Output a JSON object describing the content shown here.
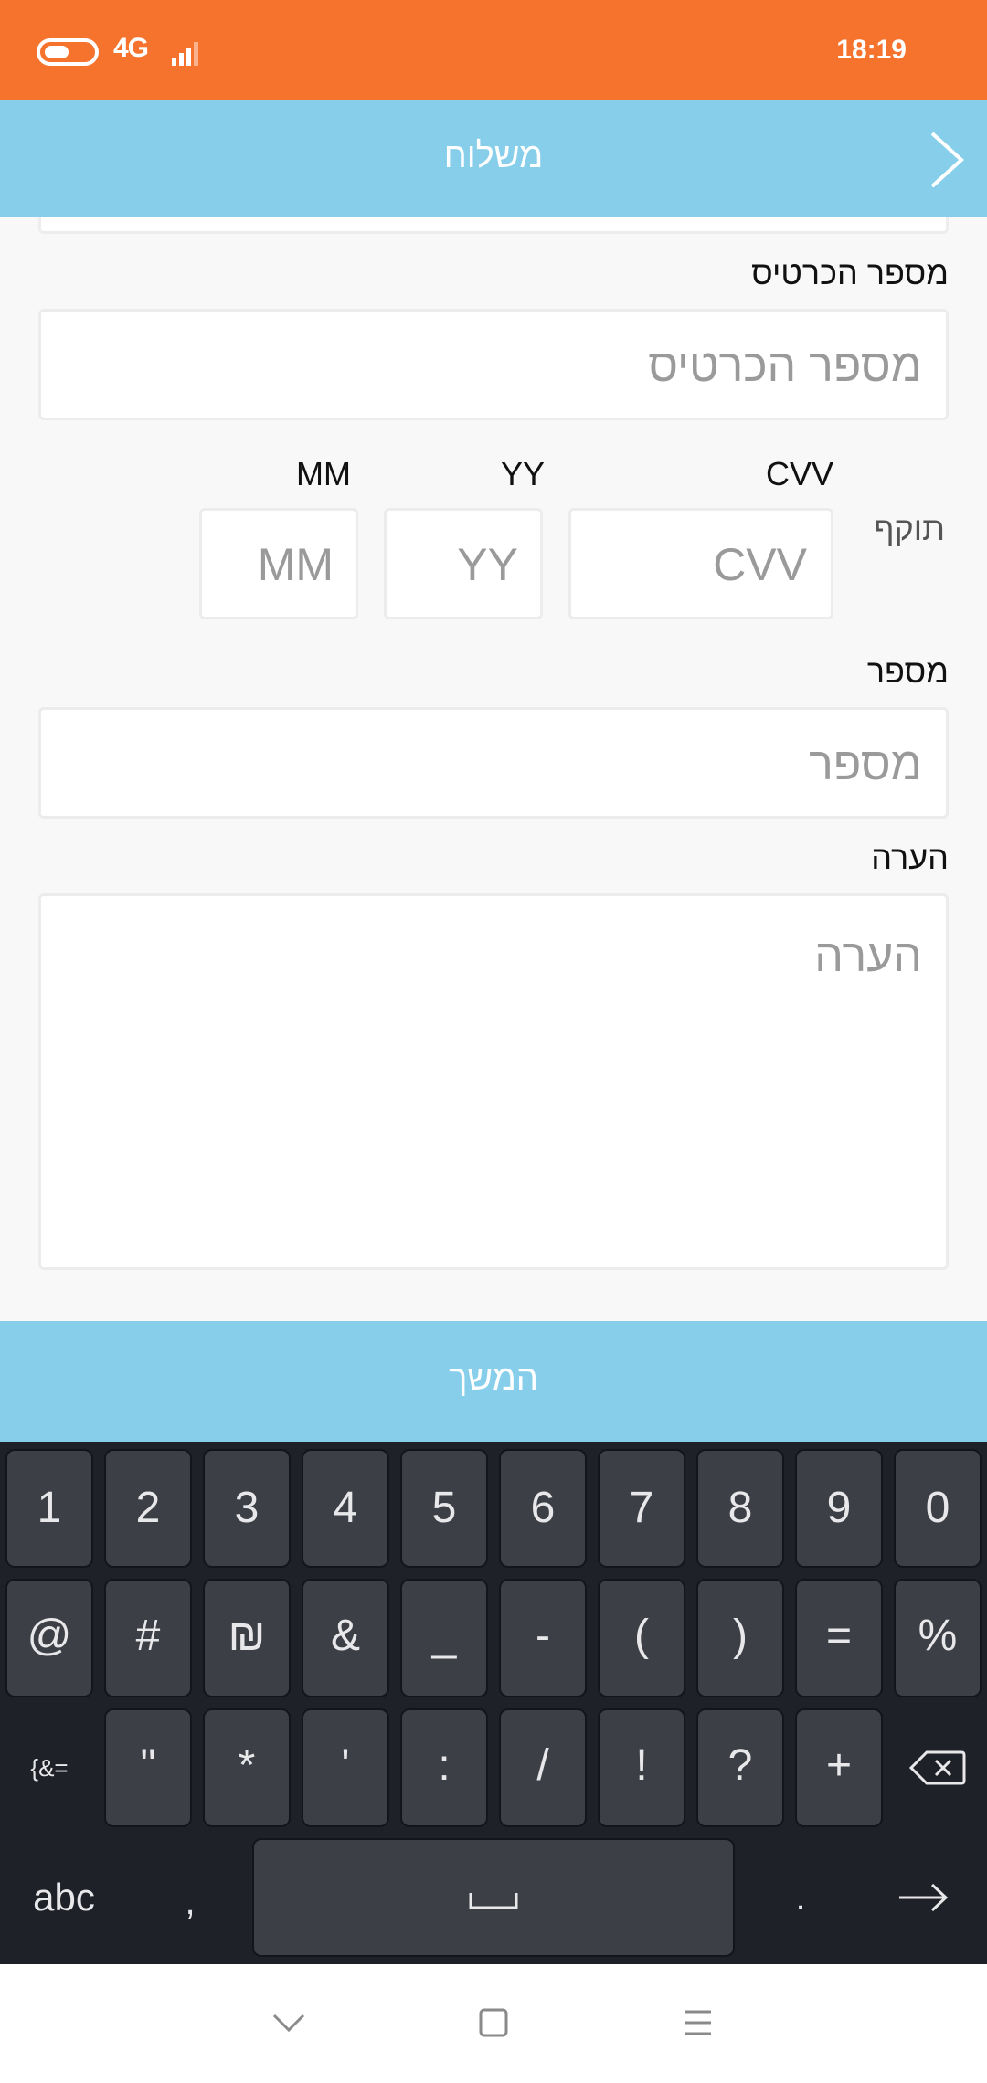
{
  "status_bar": {
    "network": "4G",
    "network_prefix": "",
    "time": "18:19",
    "icons": [
      "battery-icon",
      "signal-icon"
    ]
  },
  "header": {
    "title": "משלוח",
    "back_icon": "chevron-right-icon"
  },
  "form": {
    "card_number": {
      "label": "מספר הכרטיס",
      "placeholder": "מספר הכרטיס"
    },
    "expiry": {
      "label": "תוקף",
      "cvv": {
        "label": "CVV",
        "placeholder": "CVV"
      },
      "year": {
        "label": "YY",
        "placeholder": "YY"
      },
      "month": {
        "label": "MM",
        "placeholder": "MM"
      }
    },
    "number": {
      "label": "מספר",
      "placeholder": "מספר"
    },
    "note": {
      "label": "הערה",
      "placeholder": "הערה"
    }
  },
  "continue_button": {
    "label": "המשך"
  },
  "keyboard": {
    "row1": [
      "1",
      "2",
      "3",
      "4",
      "5",
      "6",
      "7",
      "8",
      "9",
      "0"
    ],
    "row2": [
      "@",
      "#",
      "₪",
      "&",
      "_",
      "-",
      "(",
      ")",
      "=",
      "%"
    ],
    "row3_toggle": "{&=",
    "row3": [
      "\"",
      "*",
      "'",
      ":",
      "/",
      "!",
      "?",
      "+"
    ],
    "backspace_icon": "backspace-icon",
    "abc_label": "abc",
    "comma": ",",
    "period": ".",
    "space_icon": "space-icon",
    "enter_icon": "arrow-right-icon"
  },
  "nav_bar": {
    "icons": [
      "chevron-down-icon",
      "square-icon",
      "menu-icon"
    ]
  },
  "colors": {
    "status_bar": "#f5732d",
    "accent": "#87ceeb",
    "keyboard_bg": "#1f2128",
    "key_bg": "#3d3f46"
  }
}
